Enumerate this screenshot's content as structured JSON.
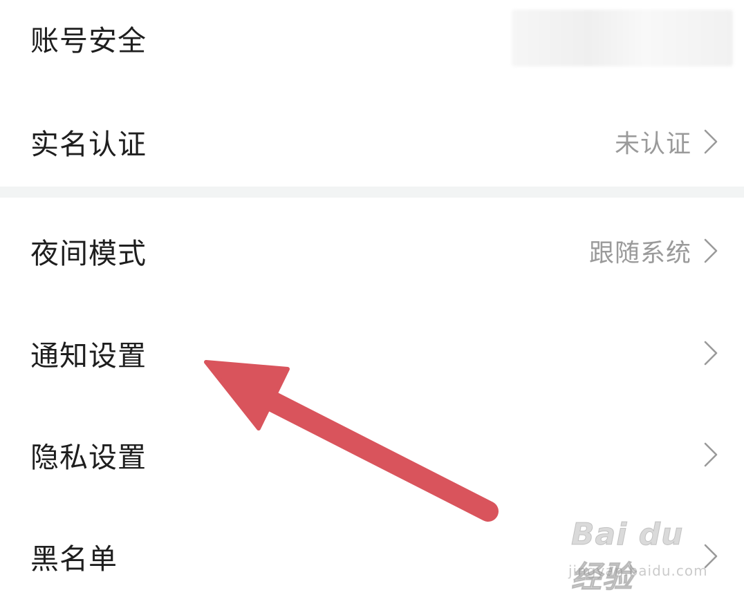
{
  "settings": {
    "account_security": {
      "label": "账号安全",
      "value": ""
    },
    "real_name": {
      "label": "实名认证",
      "value": "未认证"
    },
    "night_mode": {
      "label": "夜间模式",
      "value": "跟随系统"
    },
    "notifications": {
      "label": "通知设置",
      "value": ""
    },
    "privacy": {
      "label": "隐私设置",
      "value": ""
    },
    "blacklist": {
      "label": "黑名单",
      "value": ""
    }
  },
  "icons": {
    "chevron": "chevron-right-icon",
    "annotation_arrow": "arrow-icon"
  },
  "colors": {
    "arrow": "#d9545c",
    "label": "#1e1e1e",
    "value": "#9a9a9a",
    "divider": "#f2f4f4"
  },
  "watermark": {
    "brand": "Bai du 经验",
    "url": "jingyan.baidu.com"
  }
}
